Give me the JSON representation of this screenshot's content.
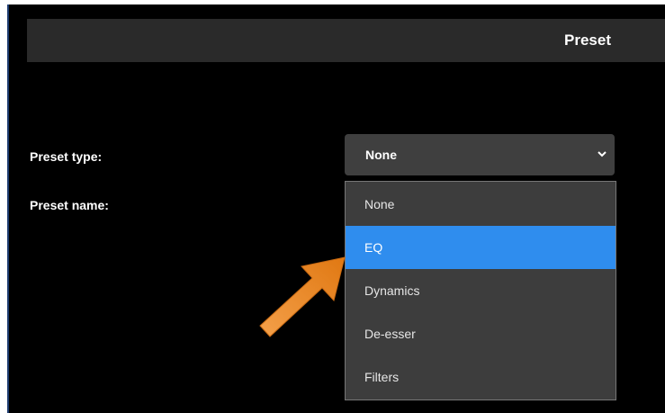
{
  "header": {
    "title": "Preset"
  },
  "form": {
    "preset_type_label": "Preset type:",
    "preset_name_label": "Preset name:"
  },
  "select": {
    "value": "None",
    "options": [
      "None",
      "EQ",
      "Dynamics",
      "De-esser",
      "Filters"
    ],
    "highlighted": "EQ"
  },
  "icons": {
    "dropdown": "chevron-down-icon",
    "pointer": "orange-arrow-annotation"
  },
  "colors": {
    "highlight": "#2f8dee",
    "arrow": "#f08a24",
    "panel_bg": "#000000",
    "control_bg": "#3f3f3f"
  }
}
